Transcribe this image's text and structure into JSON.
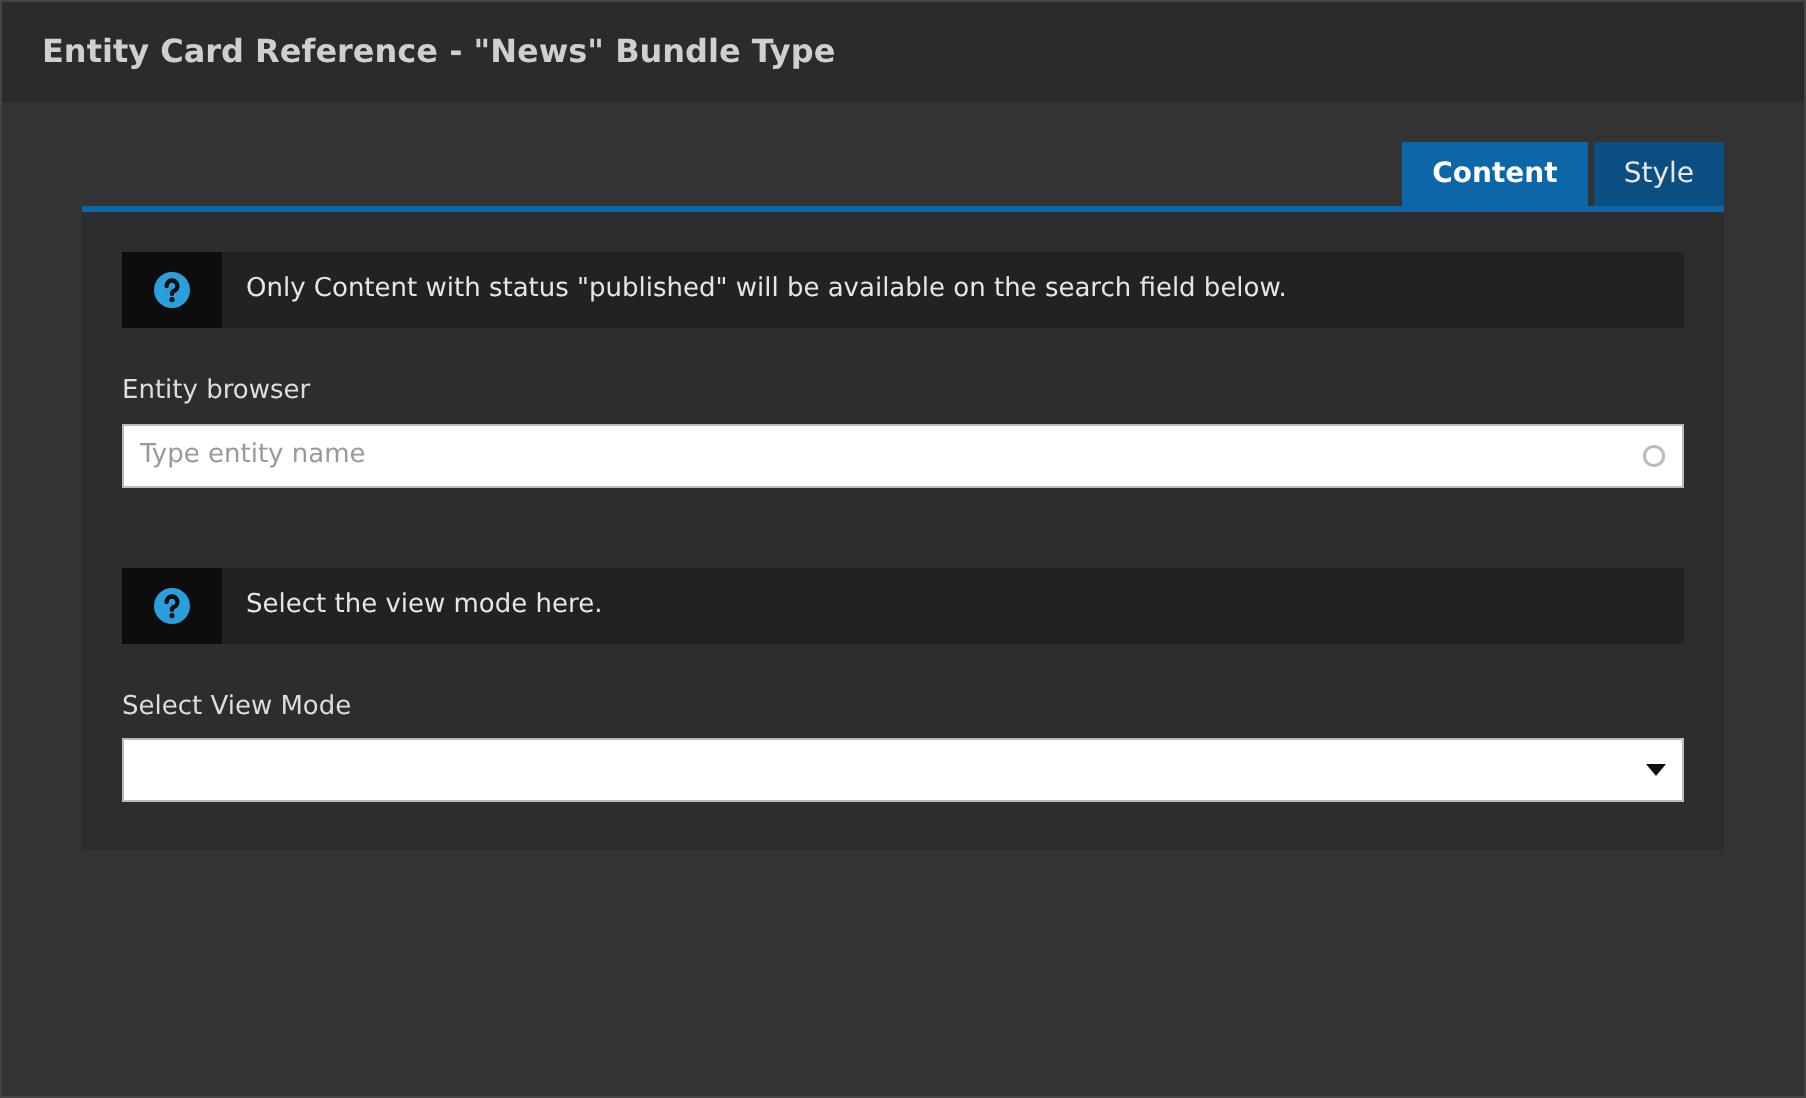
{
  "window": {
    "title": "Entity Card Reference - \"News\" Bundle Type"
  },
  "tabs": [
    {
      "label": "Content",
      "selected": true
    },
    {
      "label": "Style",
      "selected": false
    }
  ],
  "sections": [
    {
      "kind": "autocomplete",
      "info": "Only Content with status \"published\" will be available on the search field below.",
      "label": "Entity browser",
      "placeholder": "Type entity name"
    },
    {
      "kind": "select",
      "info": "Select the view mode here.",
      "label": "Select View Mode"
    }
  ]
}
